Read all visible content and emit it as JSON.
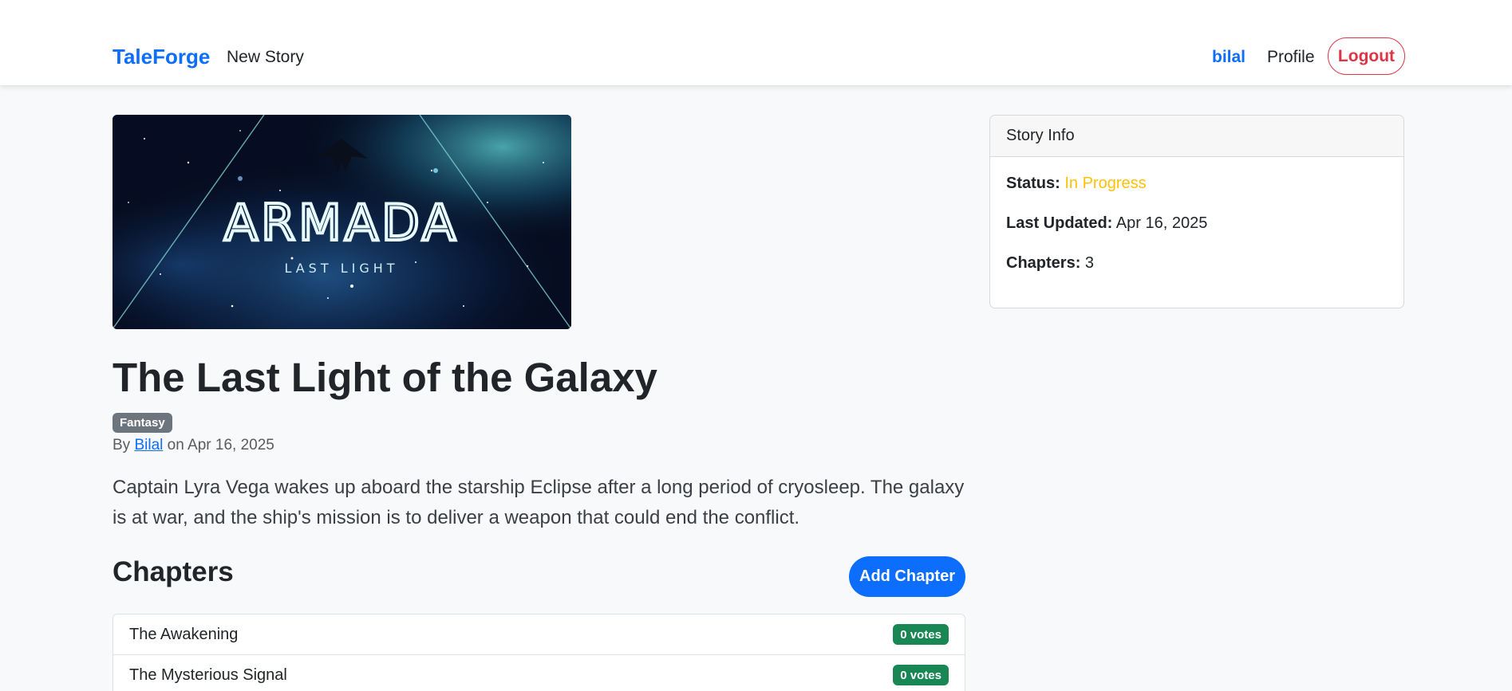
{
  "navbar": {
    "brand": "TaleForge",
    "new_story": "New Story",
    "username": "bilal",
    "profile": "Profile",
    "logout": "Logout"
  },
  "cover": {
    "title_text": "ARMADA",
    "subtitle_text": "LAST LIGHT"
  },
  "story": {
    "title": "The Last Light of the Galaxy",
    "genre": "Fantasy",
    "by_prefix": "By",
    "author": "Bilal",
    "date_prefix": "on",
    "date": "Apr 16, 2025",
    "description": "Captain Lyra Vega wakes up aboard the starship Eclipse after a long period of cryosleep. The galaxy is at war, and the ship's mission is to deliver a weapon that could end the conflict."
  },
  "chapters": {
    "heading": "Chapters",
    "add_button": "Add Chapter",
    "items": [
      {
        "title": "The Awakening",
        "votes": "0 votes"
      },
      {
        "title": "The Mysterious Signal",
        "votes": "0 votes"
      }
    ]
  },
  "info": {
    "header": "Story Info",
    "status_label": "Status:",
    "status_value": "In Progress",
    "updated_label": "Last Updated:",
    "updated_value": "Apr 16, 2025",
    "chapters_label": "Chapters:",
    "chapters_value": "3"
  },
  "colors": {
    "primary": "#0d6efd",
    "danger": "#dc3545",
    "warning": "#ffc107",
    "success": "#198754",
    "secondary": "#6c757d"
  }
}
